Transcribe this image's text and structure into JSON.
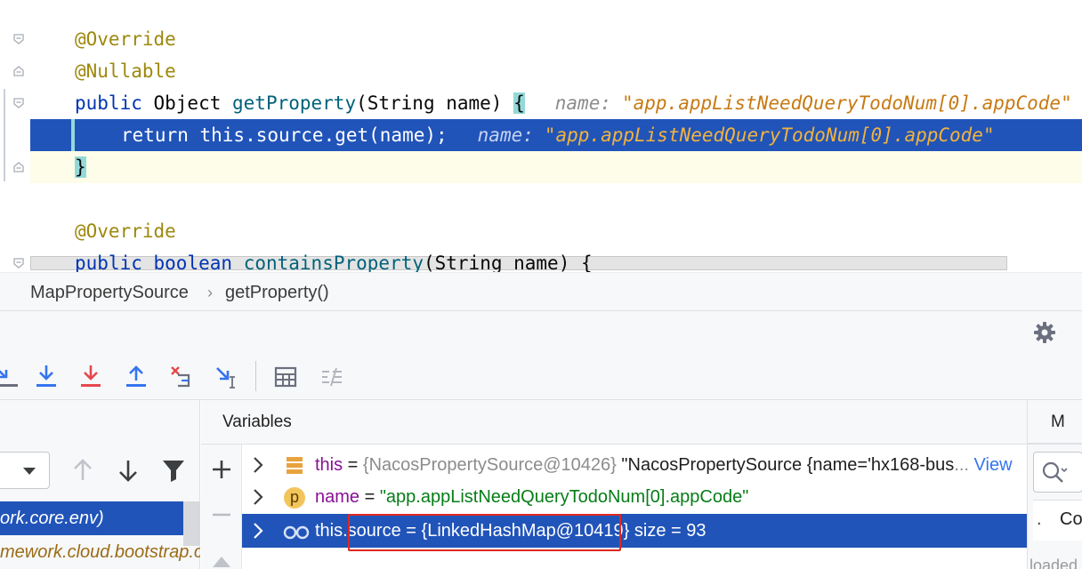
{
  "editor": {
    "lines": {
      "override1": "@Override",
      "nullable": "@Nullable",
      "sig_kw": "public",
      "sig_type": " Object ",
      "sig_fn": "getProperty",
      "sig_params": "(String name) ",
      "sig_brace": "{",
      "return_stmt": "return this.source.get(name);",
      "close_brace": "}",
      "override2": "@Override",
      "sig2_kw1": "public",
      "sig2_kw2": "boolean",
      "sig2_fn": "containsProperty",
      "sig2_params": "(String name) {"
    },
    "inlay_hints": {
      "sig_hint_name": "name:",
      "sig_hint_value": "\"app.appListNeedQueryTodoNum[0].appCode\"",
      "return_hint_name": "name:",
      "return_hint_value": "\"app.appListNeedQueryTodoNum[0].appCode\""
    }
  },
  "breadcrumb": {
    "class_name": "MapPropertySource",
    "separator": "›",
    "method_name": "getProperty()"
  },
  "frames": {
    "rows": [
      {
        "text": "ork.core.env)"
      },
      {
        "text": "mework.cloud.bootstrap.c"
      }
    ]
  },
  "variables": {
    "title": "Variables",
    "rows": [
      {
        "name": "this",
        "eq": " = ",
        "ref": "{NacosPropertySource@10426}",
        "value": " \"NacosPropertySource {name='hx168-bus",
        "ellipsis": "...",
        "link": " View"
      },
      {
        "icon_letter": "p",
        "name": "name",
        "eq": " = ",
        "value": "\"app.appListNeedQueryTodoNum[0].appCode\""
      },
      {
        "name": "this.source",
        "eq": " = ",
        "ref": "{LinkedHashMap@10419}",
        "extra": "  size = 93"
      }
    ]
  },
  "right_panel": {
    "tab_label": "M",
    "console_dot": ".",
    "console_label": "Co",
    "loaded_text": "loaded"
  },
  "colors": {
    "selection": "#2154b9",
    "annotation": "#9e880d",
    "keyword": "#0033b3",
    "string": "#067d17",
    "field": "#871094",
    "highlight_box": "#e0281f"
  }
}
